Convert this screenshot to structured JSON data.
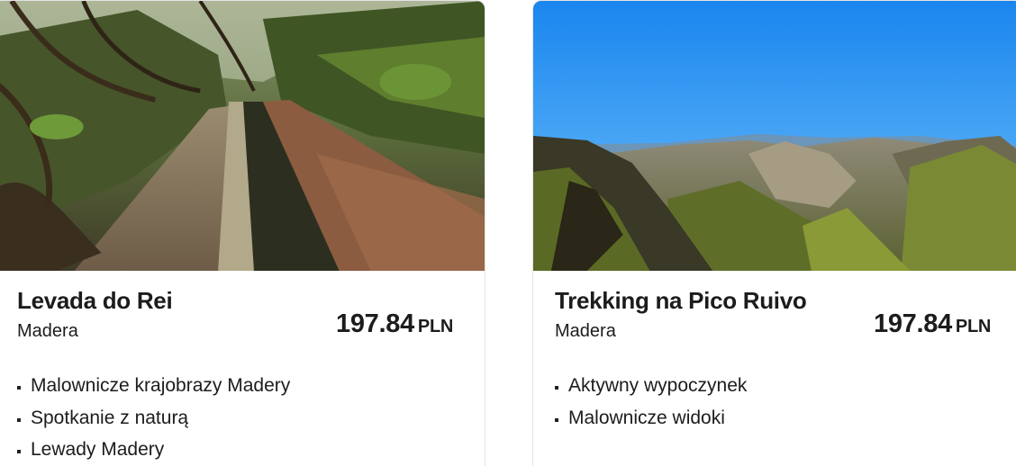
{
  "tours": [
    {
      "title": "Levada do Rei",
      "location": "Madera",
      "price": "197.84",
      "currency": "PLN",
      "features": [
        "Malownicze krajobrazy Madery",
        "Spotkanie z naturą",
        "Lewady Madery"
      ],
      "image_icon": "forest-levada-path-photo"
    },
    {
      "title": "Trekking na Pico Ruivo",
      "location": "Madera",
      "price": "197.84",
      "currency": "PLN",
      "features": [
        "Aktywny wypoczynek",
        "Malownicze widoki"
      ],
      "image_icon": "mountain-peaks-photo"
    }
  ],
  "colors": {
    "text": "#1c1c1c",
    "card_border": "#e4e4e4",
    "sky": "#1f8ef0",
    "forest": "#4a5a2c"
  }
}
